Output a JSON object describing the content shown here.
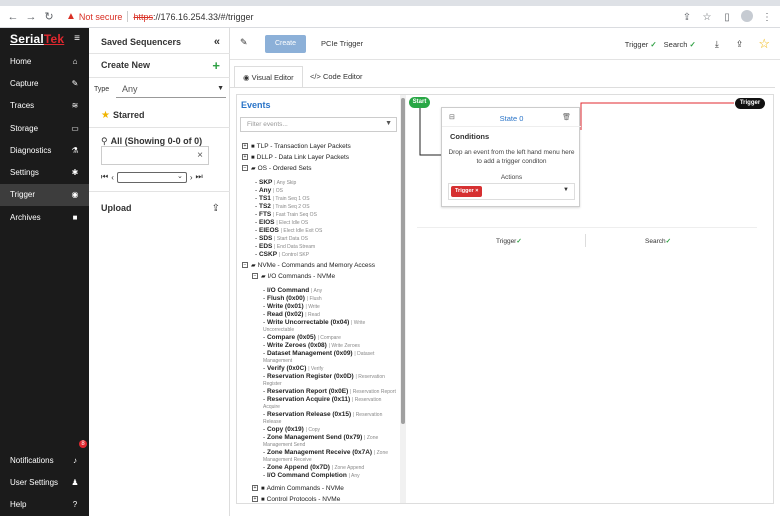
{
  "browser": {
    "not_secure": "Not secure",
    "url_scheme": "https",
    "url_rest": "://176.16.254.33/#/trigger"
  },
  "brand": {
    "part1": "Serial",
    "part2": "Tek"
  },
  "nav": {
    "items": [
      {
        "label": "Home",
        "icon": "home-icon",
        "glyph": "⌂"
      },
      {
        "label": "Capture",
        "icon": "wrench-icon",
        "glyph": "✎"
      },
      {
        "label": "Traces",
        "icon": "chart-icon",
        "glyph": "≋"
      },
      {
        "label": "Storage",
        "icon": "drive-icon",
        "glyph": "▭"
      },
      {
        "label": "Diagnostics",
        "icon": "flask-icon",
        "glyph": "⚗"
      },
      {
        "label": "Settings",
        "icon": "gear-icon",
        "glyph": "✱"
      },
      {
        "label": "Trigger",
        "icon": "target-icon",
        "glyph": "◉"
      },
      {
        "label": "Archives",
        "icon": "archive-icon",
        "glyph": "■"
      }
    ],
    "bottom": [
      {
        "label": "Notifications",
        "icon": "bell-icon",
        "glyph": "♪"
      },
      {
        "label": "User Settings",
        "icon": "user-icon",
        "glyph": "♟"
      },
      {
        "label": "Help",
        "icon": "help-icon",
        "glyph": "?"
      }
    ],
    "notification_count": "8"
  },
  "panel2": {
    "saved_title": "Saved Sequencers",
    "collapse_glyph": "«",
    "create_new": "Create New",
    "type_label": "Type",
    "type_value": "Any",
    "starred": "Starred",
    "all_label": "All (Showing 0-0 of 0)",
    "upload": "Upload"
  },
  "topbar": {
    "create_label": "Create",
    "trigger_name": "PCIe Trigger",
    "trigger_status": "Trigger",
    "search_status": "Search"
  },
  "tabs": {
    "visual": "Visual Editor",
    "code": "Code Editor"
  },
  "events": {
    "title": "Events",
    "filter_placeholder": "Filter events...",
    "groups": [
      {
        "label": "TLP - Transaction Layer Packets"
      },
      {
        "label": "DLLP - Data Link Layer Packets"
      },
      {
        "label": "OS - Ordered Sets"
      }
    ],
    "os_items": [
      {
        "name": "SKP",
        "desc": "Any Skip"
      },
      {
        "name": "Any",
        "desc": "OS"
      },
      {
        "name": "TS1",
        "desc": "Train Seq 1 OS"
      },
      {
        "name": "TS2",
        "desc": "Train Seq 2 OS"
      },
      {
        "name": "FTS",
        "desc": "Fast Train Seq OS"
      },
      {
        "name": "EIOS",
        "desc": "Elect Idle OS"
      },
      {
        "name": "EIEOS",
        "desc": "Elect Idle Exit OS"
      },
      {
        "name": "SDS",
        "desc": "Start Data OS"
      },
      {
        "name": "EDS",
        "desc": "End Data Stream"
      },
      {
        "name": "CSKP",
        "desc": "Control SKP"
      }
    ],
    "nvme_group": "NVMe - Commands and Memory Access",
    "io_group": "I/O Commands - NVMe",
    "io_items": [
      {
        "name": "I/O Command",
        "desc": "Any"
      },
      {
        "name": "Flush (0x00)",
        "desc": "Flush"
      },
      {
        "name": "Write (0x01)",
        "desc": "Write"
      },
      {
        "name": "Read (0x02)",
        "desc": "Read"
      },
      {
        "name": "Write Uncorrectable (0x04)",
        "desc": "Write",
        "cont": "Uncorrectable"
      },
      {
        "name": "Compare (0x05)",
        "desc": "Compare"
      },
      {
        "name": "Write Zeroes (0x08)",
        "desc": "Write Zeroes"
      },
      {
        "name": "Dataset Management (0x09)",
        "desc": "Dataset",
        "cont": "Management"
      },
      {
        "name": "Verify (0x0C)",
        "desc": "Verify"
      },
      {
        "name": "Reservation Register (0x0D)",
        "desc": "Reservation",
        "cont": "Register"
      },
      {
        "name": "Reservation Report (0x0E)",
        "desc": "Reservation Report"
      },
      {
        "name": "Reservation Acquire (0x11)",
        "desc": "Reservation",
        "cont": "Acquire"
      },
      {
        "name": "Reservation Release (0x15)",
        "desc": "Reservation",
        "cont": "Release"
      },
      {
        "name": "Copy (0x19)",
        "desc": "Copy"
      },
      {
        "name": "Zone Management Send (0x79)",
        "desc": "Zone",
        "cont": "Management Send"
      },
      {
        "name": "Zone Management Receive (0x7A)",
        "desc": "Zone",
        "cont": "Management Receive"
      },
      {
        "name": "Zone Append (0x7D)",
        "desc": "Zone Append"
      },
      {
        "name": "I/O Command Completion",
        "desc": "Any"
      }
    ],
    "admin_group": "Admin Commands - NVMe",
    "cut_group": "Control Protocols - NVMe"
  },
  "canvas": {
    "start": "Start",
    "trigger": "Trigger",
    "state_title": "State 0",
    "conditions": "Conditions",
    "drop_text": "Drop an event from the left hand menu here to add a trigger conditon",
    "actions": "Actions",
    "action_tag": "Trigger",
    "bottom_trigger": "Trigger",
    "bottom_search": "Search"
  },
  "colors": {
    "accent_blue": "#2a74c8",
    "danger_red": "#d63031",
    "success_green": "#28a745",
    "sidebar_bg": "#1b1b1b"
  }
}
